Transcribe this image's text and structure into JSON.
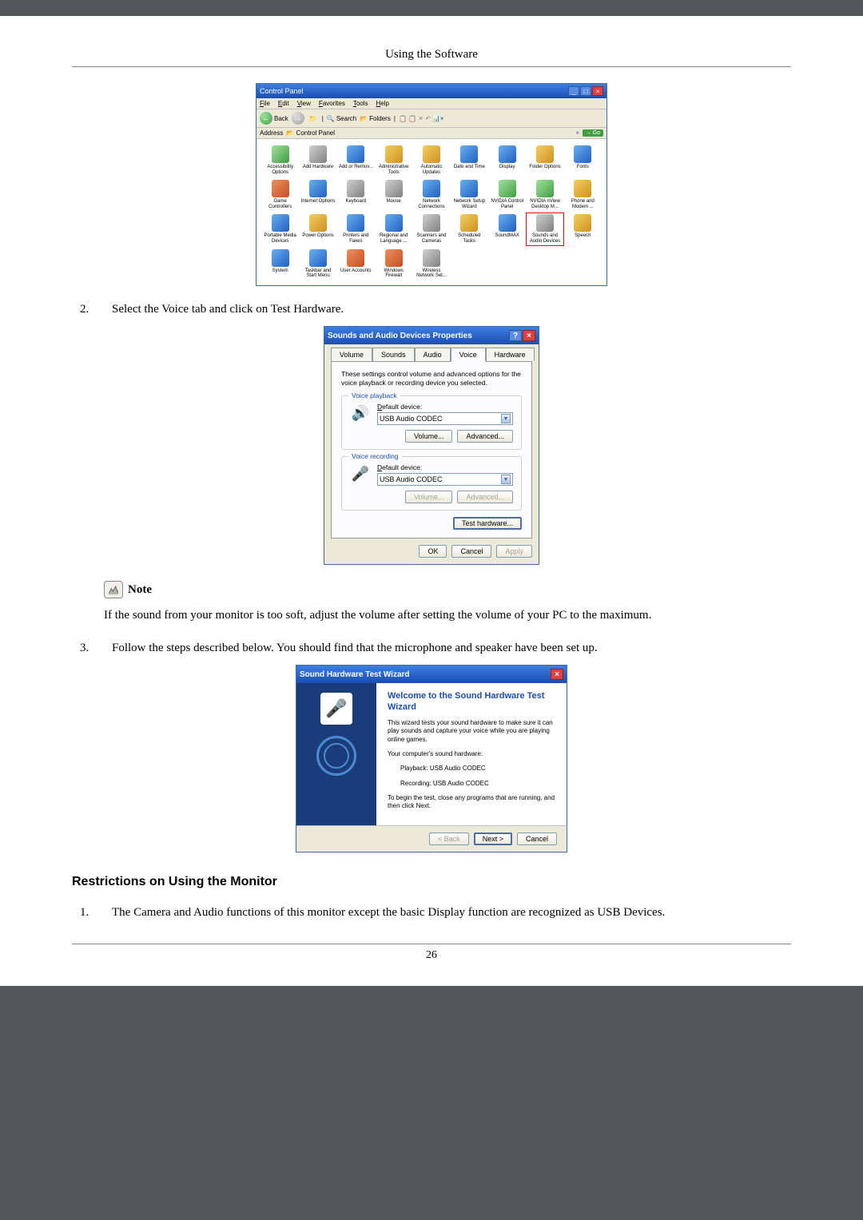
{
  "page_header": "Using the Software",
  "page_number": "26",
  "control_panel": {
    "title": "Control Panel",
    "menu": [
      "File",
      "Edit",
      "View",
      "Favorites",
      "Tools",
      "Help"
    ],
    "toolbar": {
      "back": "Back",
      "search": "Search",
      "folders": "Folders"
    },
    "address_label": "Address",
    "address_value": "Control Panel",
    "go": "Go",
    "items": [
      {
        "label": "Accessibility Options",
        "cls": "c1"
      },
      {
        "label": "Add Hardware",
        "cls": "c3"
      },
      {
        "label": "Add or Remov...",
        "cls": ""
      },
      {
        "label": "Administrative Tools",
        "cls": "c2"
      },
      {
        "label": "Automatic Updates",
        "cls": "c2"
      },
      {
        "label": "Date and Time",
        "cls": ""
      },
      {
        "label": "Display",
        "cls": ""
      },
      {
        "label": "Folder Options",
        "cls": "c2"
      },
      {
        "label": "Fonts",
        "cls": ""
      },
      {
        "label": "Game Controllers",
        "cls": "c4"
      },
      {
        "label": "Internet Options",
        "cls": ""
      },
      {
        "label": "Keyboard",
        "cls": "c3"
      },
      {
        "label": "Mouse",
        "cls": "c3"
      },
      {
        "label": "Network Connections",
        "cls": ""
      },
      {
        "label": "Network Setup Wizard",
        "cls": ""
      },
      {
        "label": "NVIDIA Control Panel",
        "cls": "c1"
      },
      {
        "label": "NVIDIA nView Desktop M...",
        "cls": "c1"
      },
      {
        "label": "Phone and Modem ...",
        "cls": "c2"
      },
      {
        "label": "Portable Media Devices",
        "cls": ""
      },
      {
        "label": "Power Options",
        "cls": "c2"
      },
      {
        "label": "Printers and Faxes",
        "cls": ""
      },
      {
        "label": "Regional and Language ...",
        "cls": ""
      },
      {
        "label": "Scanners and Cameras",
        "cls": "c3"
      },
      {
        "label": "Scheduled Tasks",
        "cls": "c2"
      },
      {
        "label": "SoundMAX",
        "cls": ""
      },
      {
        "label": "Sounds and Audio Devices",
        "cls": "c3",
        "hl": true
      },
      {
        "label": "Speech",
        "cls": "c2"
      },
      {
        "label": "System",
        "cls": ""
      },
      {
        "label": "Taskbar and Start Menu",
        "cls": ""
      },
      {
        "label": "User Accounts",
        "cls": "c4"
      },
      {
        "label": "Windows Firewall",
        "cls": "c4"
      },
      {
        "label": "Wireless Network Set...",
        "cls": "c3"
      }
    ]
  },
  "step2": {
    "num": "2.",
    "text": "Select the Voice tab and click on Test Hardware."
  },
  "dialog": {
    "title": "Sounds and Audio Devices Properties",
    "tabs": [
      "Volume",
      "Sounds",
      "Audio",
      "Voice",
      "Hardware"
    ],
    "active_tab": "Voice",
    "description": "These settings control volume and advanced options for the voice playback or recording device you selected.",
    "playback": {
      "legend": "Voice playback",
      "label": "Default device:",
      "value": "USB Audio CODEC",
      "volume_btn": "Volume...",
      "advanced_btn": "Advanced..."
    },
    "recording": {
      "legend": "Voice recording",
      "label": "Default device:",
      "value": "USB Audio CODEC",
      "volume_btn": "Volume...",
      "advanced_btn": "Advanced..."
    },
    "test_btn": "Test hardware...",
    "ok": "OK",
    "cancel": "Cancel",
    "apply": "Apply"
  },
  "note": {
    "label": "Note",
    "text": "If the sound from your monitor is too soft, adjust the volume after setting the volume of your PC to the maximum."
  },
  "step3": {
    "num": "3.",
    "text": "Follow the steps described below. You should find that the microphone and speaker have been set up."
  },
  "wizard": {
    "window_title": "Sound Hardware Test Wizard",
    "title": "Welcome to the Sound Hardware Test Wizard",
    "p1": "This wizard tests your sound hardware to make sure it can play sounds and capture your voice while you are playing online games.",
    "p2": "Your computer's sound hardware:",
    "playback": "Playback: USB Audio CODEC",
    "recording": "Recording: USB Audio CODEC",
    "p3": "To begin the test, close any programs that are running, and then click Next.",
    "back": "< Back",
    "next": "Next >",
    "cancel": "Cancel"
  },
  "section_heading": "Restrictions on Using the Monitor",
  "step1_restrict": {
    "num": "1.",
    "text": "The Camera and Audio functions of this monitor except the basic Display function are recognized as USB Devices."
  }
}
